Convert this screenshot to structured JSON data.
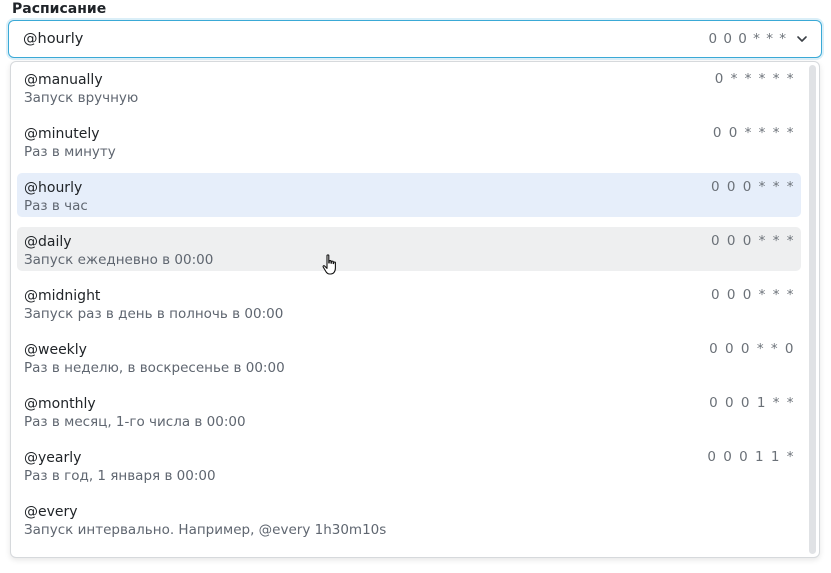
{
  "field": {
    "label": "Расписание"
  },
  "select": {
    "value": "@hourly",
    "cron": "0 0 0 * * *",
    "chevron_icon": "chevron-down-icon"
  },
  "options": [
    {
      "name": "@manually",
      "desc": "Запуск вручную",
      "cron": "0 * * * * *"
    },
    {
      "name": "@minutely",
      "desc": "Раз в минуту",
      "cron": "0 0 * * * *"
    },
    {
      "name": "@hourly",
      "desc": "Раз в час",
      "cron": "0 0 0 * * *"
    },
    {
      "name": "@daily",
      "desc": "Запуск ежедневно в 00:00",
      "cron": "0 0 0 * * *"
    },
    {
      "name": "@midnight",
      "desc": "Запуск раз в день в полночь в 00:00",
      "cron": "0 0 0 * * *"
    },
    {
      "name": "@weekly",
      "desc": "Раз в неделю, в воскресенье в 00:00",
      "cron": "0 0 0 * * 0"
    },
    {
      "name": "@monthly",
      "desc": "Раз в месяц, 1-го числа в 00:00",
      "cron": "0 0 0 1 * *"
    },
    {
      "name": "@yearly",
      "desc": "Раз в год, 1 января в 00:00",
      "cron": "0 0 0 1 1 *"
    },
    {
      "name": "@every",
      "desc": "Запуск интервально. Например, @every 1h30m10s",
      "cron": ""
    }
  ],
  "state": {
    "selected_index": 2,
    "hovered_index": 3
  },
  "colors": {
    "focus_border": "#3aa9d6",
    "selected_bg": "#e6eefa",
    "hover_bg": "#eeeff0"
  }
}
